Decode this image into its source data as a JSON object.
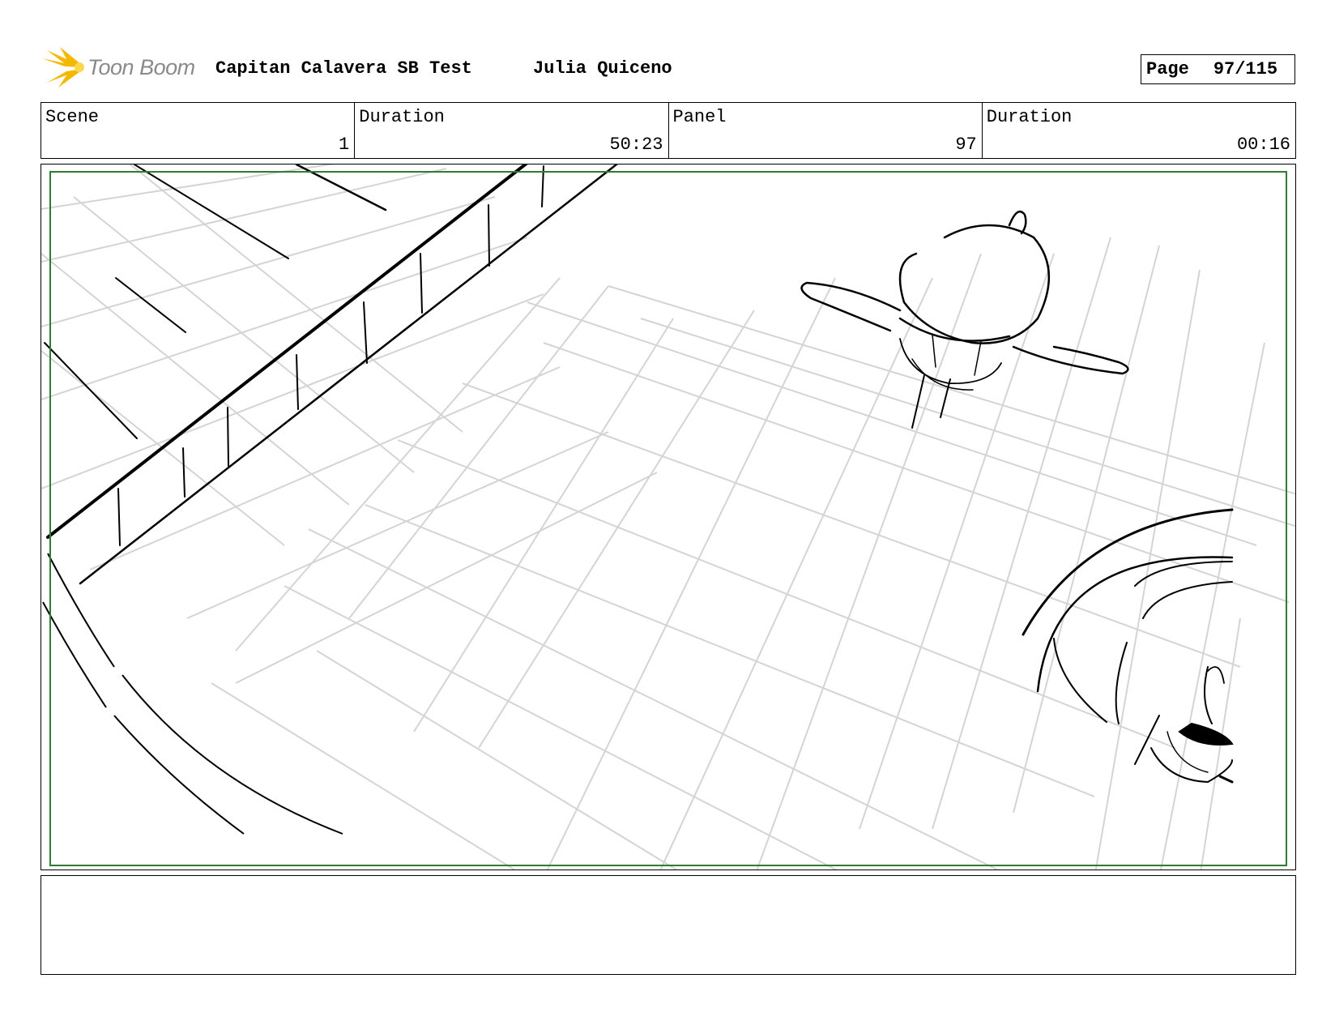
{
  "header": {
    "logo_text": "Toon Boom",
    "title": "Capitan Calavera SB Test",
    "author": "Julia Quiceno",
    "page_label": "Page",
    "page_number": "97/115"
  },
  "info": {
    "scene_label": "Scene",
    "scene_value": "1",
    "scene_duration_label": "Duration",
    "scene_duration_value": "50:23",
    "panel_label": "Panel",
    "panel_value": "97",
    "panel_duration_label": "Duration",
    "panel_duration_value": "00:16"
  },
  "colors": {
    "safe_frame": "#2e7d32",
    "logo_ray": "#f5b800",
    "logo_text": "#8a8a8a"
  },
  "notes": ""
}
